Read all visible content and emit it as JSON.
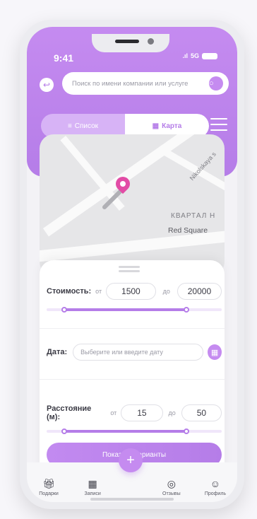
{
  "status": {
    "time": "9:41",
    "network": "5G"
  },
  "search": {
    "placeholder": "Поиск по имени компании или услуге"
  },
  "view_toggle": {
    "list_label": "Список",
    "map_label": "Карта"
  },
  "map": {
    "street_label": "Nikolskaya s",
    "district_label": "КВАРТАЛ Н",
    "landmark_label": "Red Square"
  },
  "filters": {
    "price": {
      "label": "Стоимость:",
      "from_word": "от",
      "from_value": "1500",
      "to_word": "до",
      "to_value": "20000",
      "range_min": 0.1,
      "range_max": 0.8
    },
    "date": {
      "label": "Дата:",
      "placeholder": "Выберите или введите дату"
    },
    "distance": {
      "label": "Расстояние (м):",
      "from_word": "от",
      "from_value": "15",
      "to_word": "до",
      "to_value": "50",
      "range_min": 0.1,
      "range_max": 0.8
    },
    "show_button": "Показать варианты"
  },
  "tabbar": {
    "items": [
      {
        "label": "Подарки",
        "icon": "gift-icon"
      },
      {
        "label": "Записи",
        "icon": "calendar-icon"
      },
      {
        "label": "Отзывы",
        "icon": "chat-icon"
      },
      {
        "label": "Профиль",
        "icon": "profile-icon"
      }
    ],
    "fab_icon": "plus-icon"
  },
  "colors": {
    "accent": "#b57de8",
    "pin": "#e24ca6"
  }
}
